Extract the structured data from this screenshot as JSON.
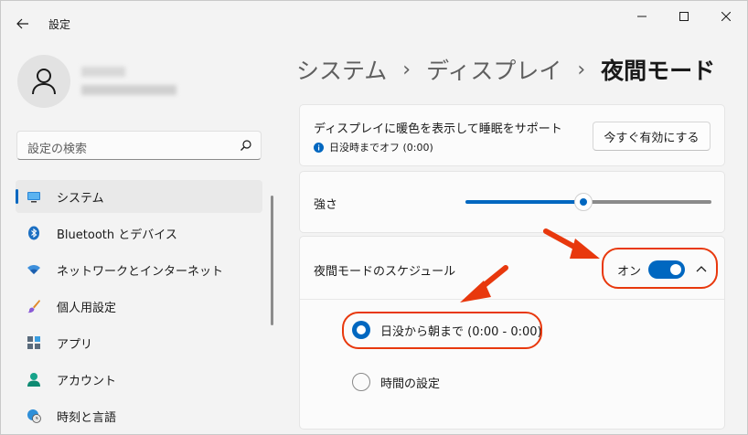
{
  "app": {
    "title": "設定"
  },
  "user": {
    "avatar_icon": "person-icon"
  },
  "search": {
    "placeholder": "設定の検索"
  },
  "sidebar": {
    "items": [
      {
        "label": "システム",
        "icon": "display-icon",
        "active": true
      },
      {
        "label": "Bluetooth とデバイス",
        "icon": "bluetooth-icon"
      },
      {
        "label": "ネットワークとインターネット",
        "icon": "wifi-icon"
      },
      {
        "label": "個人用設定",
        "icon": "brush-icon"
      },
      {
        "label": "アプリ",
        "icon": "apps-icon"
      },
      {
        "label": "アカウント",
        "icon": "account-icon"
      },
      {
        "label": "時刻と言語",
        "icon": "globe-clock-icon"
      }
    ]
  },
  "breadcrumb": {
    "part1": "システム",
    "part2": "ディスプレイ",
    "current": "夜間モード",
    "separator": "›"
  },
  "night_light": {
    "title": "ディスプレイに暖色を表示して睡眠をサポート",
    "status": "日没時までオフ (0:00)",
    "button": "今すぐ有効にする"
  },
  "strength": {
    "label": "強さ",
    "value_fraction": 0.51
  },
  "schedule": {
    "label": "夜間モードのスケジュール",
    "toggle_state": "オン",
    "toggle_on": true,
    "options": [
      {
        "label": "日没から朝まで (0:00 - 0:00)",
        "selected": true
      },
      {
        "label": "時間の設定",
        "selected": false
      }
    ]
  },
  "colors": {
    "accent": "#0067c0",
    "annotation": "#e8380d"
  }
}
